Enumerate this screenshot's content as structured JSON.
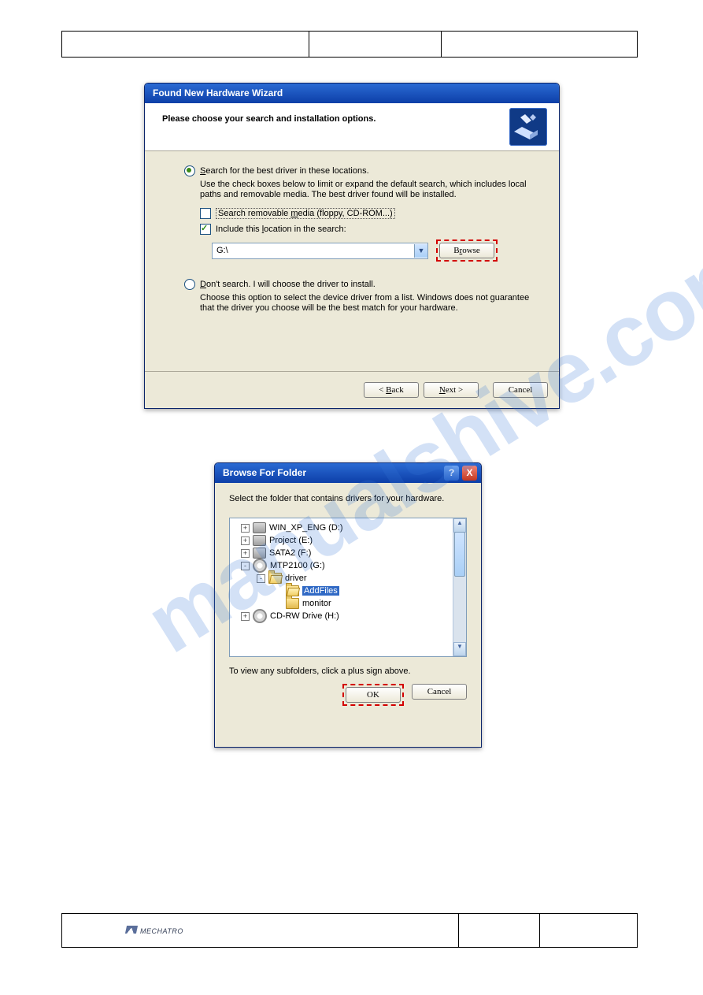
{
  "mechatro": "MECHATRO",
  "wizard": {
    "title": "Found New Hardware Wizard",
    "header": "Please choose your search and installation options.",
    "opt1_html": "<span class='u'>S</span>earch for the best driver in these locations.",
    "opt1_help": "Use the check boxes below to limit or expand the default search, which includes local paths and removable media. The best driver found will be installed.",
    "chk1_html": "Search removable <span class='u'>m</span>edia (floppy, CD-ROM...)",
    "chk2_html": "Include this <span class='u'>l</span>ocation in the search:",
    "combo_value": "G:\\",
    "browse_html": "B<span class='u'>r</span>owse",
    "opt2_html": "<span class='u'>D</span>on't search. I will choose the driver to install.",
    "opt2_help": "Choose this option to select the device driver from a list.  Windows does not guarantee that the driver you choose will be the best match for your hardware.",
    "back_html": "< <span class='u'>B</span>ack",
    "next_html": "<span class='u'>N</span>ext >",
    "cancel": "Cancel"
  },
  "browse": {
    "title": "Browse For Folder",
    "close": "X",
    "help": "?",
    "instruction": "Select the folder that contains drivers for your hardware.",
    "tree": {
      "n0": "WIN_XP_ENG (D:)",
      "n1": "Project (E:)",
      "n2": "SATA2 (F:)",
      "n3": "MTP2100 (G:)",
      "n4": "driver",
      "n5": "AddFiles",
      "n6": "monitor",
      "n7": "CD-RW Drive (H:)"
    },
    "hint": "To view any subfolders, click a plus sign above.",
    "ok": "OK",
    "cancel": "Cancel"
  },
  "watermark": "manualshive.com"
}
